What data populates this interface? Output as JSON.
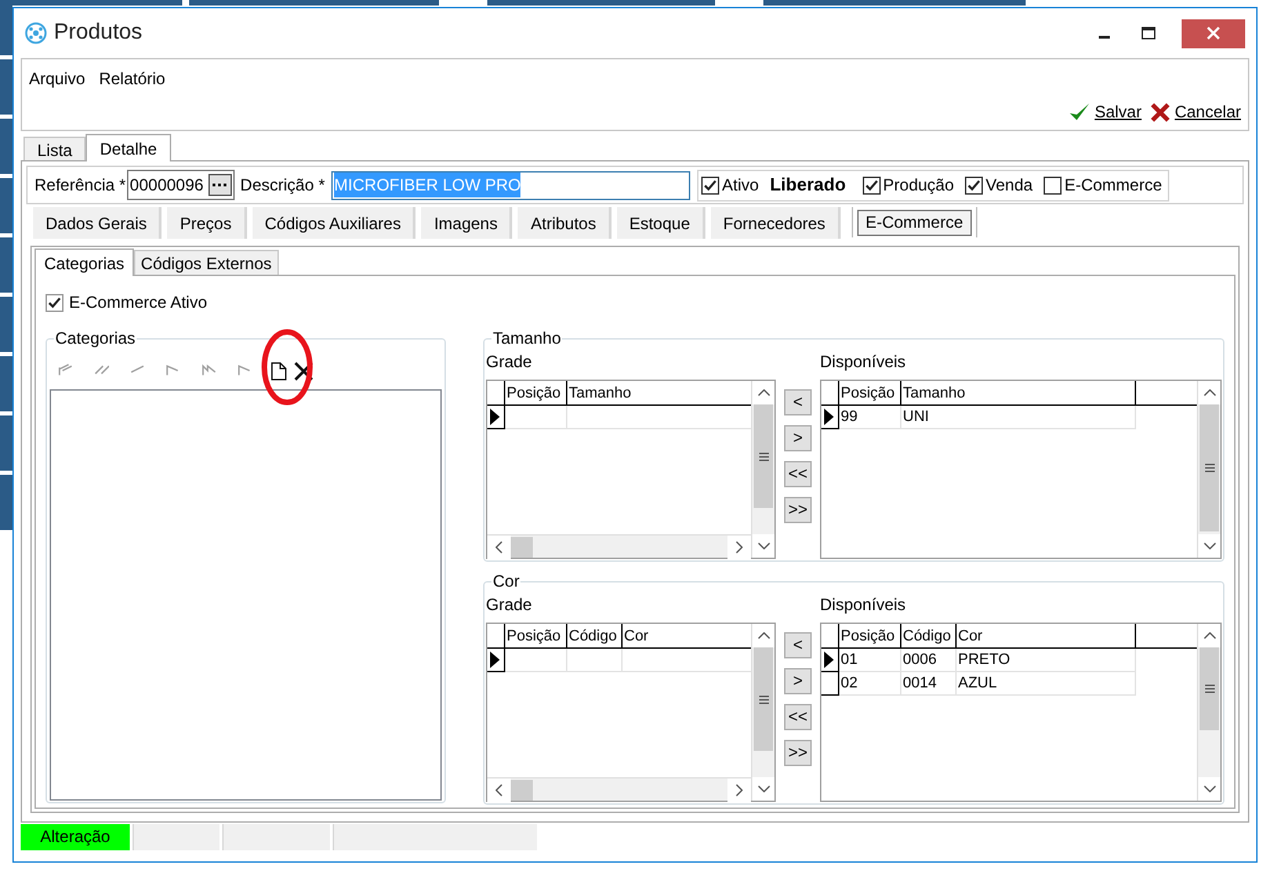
{
  "window": {
    "title": "Produtos"
  },
  "menu": [
    {
      "label": "Arquivo"
    },
    {
      "label": "Relatório"
    }
  ],
  "toolbar": [
    {
      "label": "Salvar",
      "kind": "save"
    },
    {
      "label": "Cancelar",
      "kind": "cancel"
    }
  ],
  "main_tabs": [
    {
      "label": "Lista",
      "selected": false
    },
    {
      "label": "Detalhe",
      "selected": true
    }
  ],
  "header": {
    "referencia_label": "Referência *",
    "referencia_value": "00000096",
    "descricao_label": "Descrição *",
    "descricao_value": "MICROFIBER LOW PRO",
    "flags": [
      {
        "kind": "checkbox",
        "label": "Ativo",
        "checked": true
      },
      {
        "kind": "status",
        "label": "Liberado"
      },
      {
        "kind": "checkbox",
        "label": "Produção",
        "checked": true
      },
      {
        "kind": "checkbox",
        "label": "Venda",
        "checked": true
      },
      {
        "kind": "checkbox",
        "label": "E-Commerce",
        "checked": false
      }
    ]
  },
  "section_tabs": [
    {
      "label": "Dados Gerais",
      "selected": false
    },
    {
      "label": "Preços",
      "selected": false
    },
    {
      "label": "Códigos Auxiliares",
      "selected": false
    },
    {
      "label": "Imagens",
      "selected": false
    },
    {
      "label": "Atributos",
      "selected": false
    },
    {
      "label": "Estoque",
      "selected": false
    },
    {
      "label": "Fornecedores",
      "selected": false
    },
    {
      "label": "E-Commerce",
      "selected": true
    }
  ],
  "sub_tabs": [
    {
      "label": "Categorias",
      "selected": true
    },
    {
      "label": "Códigos Externos",
      "selected": false
    }
  ],
  "ecommerce_ativo": {
    "label": "E-Commerce Ativo",
    "checked": true
  },
  "categorias": {
    "title": "Categorias"
  },
  "tamanho": {
    "title": "Tamanho",
    "grade": {
      "label": "Grade",
      "columns": [
        "Posição",
        "Tamanho"
      ]
    },
    "move_buttons": [
      "<",
      ">",
      "<<",
      ">>"
    ],
    "disponiveis": {
      "label": "Disponíveis",
      "columns": [
        "Posição",
        "Tamanho"
      ],
      "rows": [
        {
          "cells": [
            "99",
            "UNI"
          ],
          "selected": true
        }
      ]
    }
  },
  "cor": {
    "title": "Cor",
    "grade": {
      "label": "Grade",
      "columns": [
        "Posição",
        "Código",
        "Cor"
      ]
    },
    "move_buttons": [
      "<",
      ">",
      "<<",
      ">>"
    ],
    "disponiveis": {
      "label": "Disponíveis",
      "columns": [
        "Posição",
        "Código",
        "Cor"
      ],
      "rows": [
        {
          "cells": [
            "01",
            "0006",
            "PRETO"
          ],
          "selected": true
        },
        {
          "cells": [
            "02",
            "0014",
            "AZUL"
          ],
          "selected": false
        }
      ]
    }
  },
  "status_bar": {
    "mode": "Alteração"
  }
}
